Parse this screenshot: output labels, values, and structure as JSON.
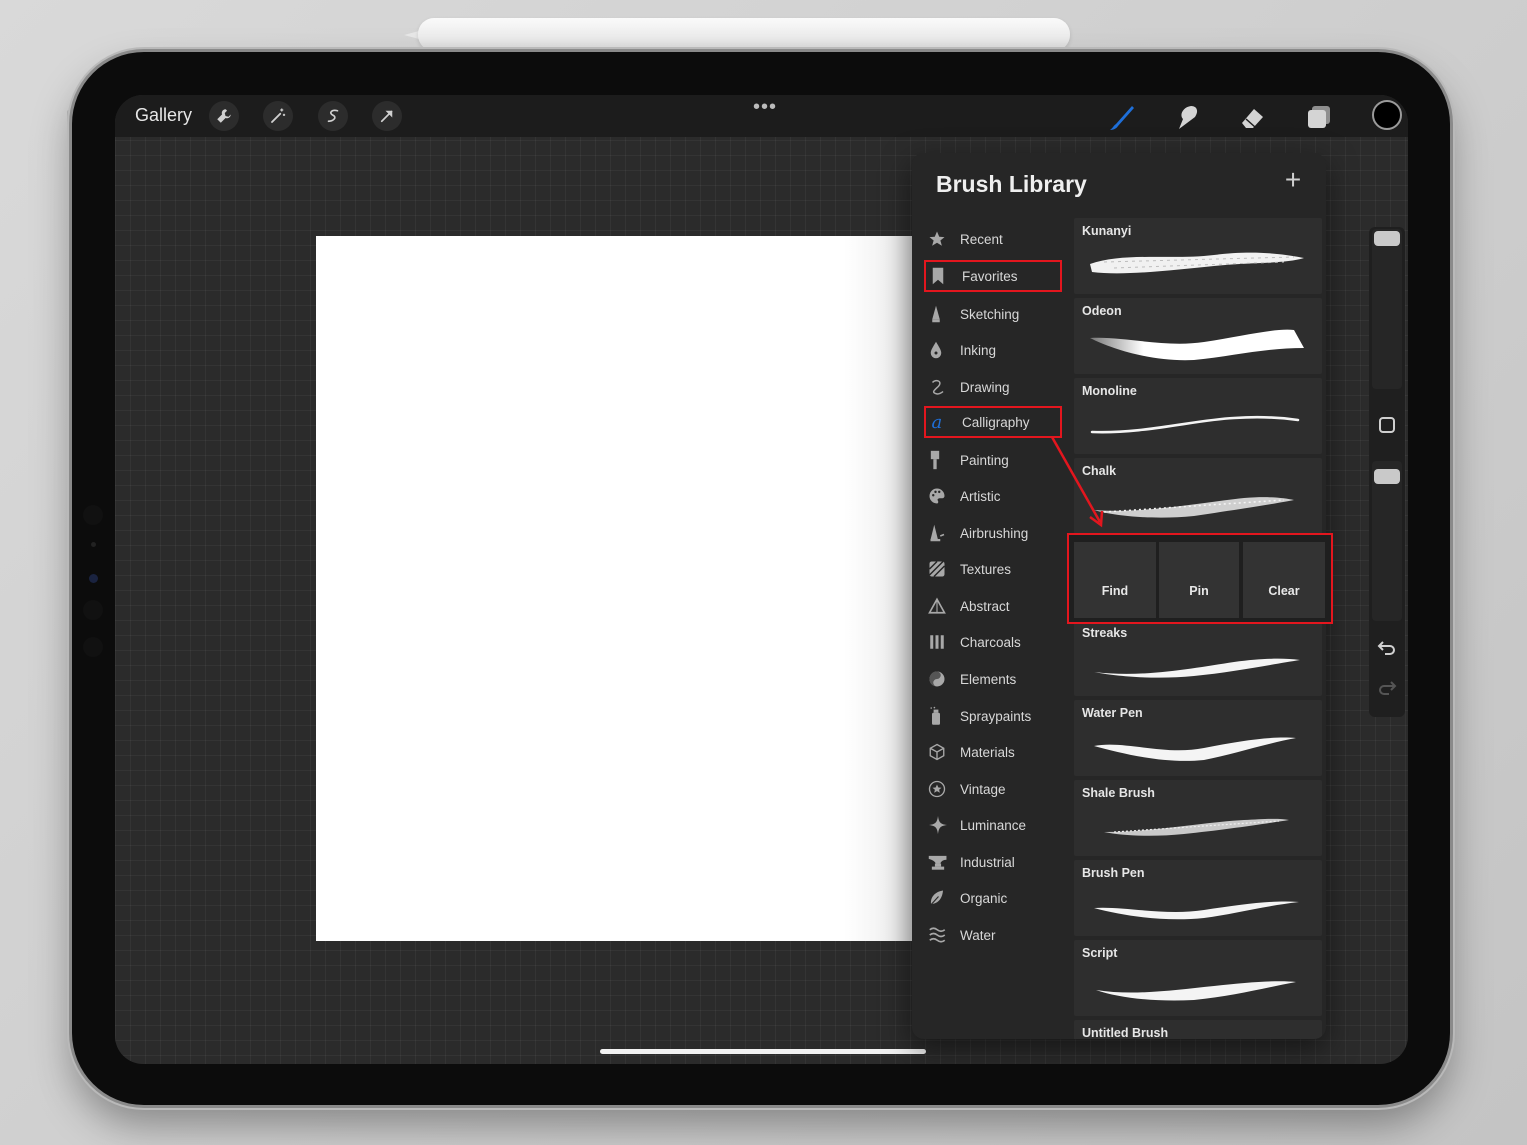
{
  "topbar": {
    "gallery_label": "Gallery",
    "more_label": "•••"
  },
  "panel": {
    "title": "Brush Library",
    "add_label": "+"
  },
  "categories": [
    {
      "label": "Recent",
      "icon": "star-icon",
      "highlighted": false
    },
    {
      "label": "Favorites",
      "icon": "bookmark-icon",
      "highlighted": true
    },
    {
      "label": "Sketching",
      "icon": "pencil-icon",
      "highlighted": false
    },
    {
      "label": "Inking",
      "icon": "ink-drop-icon",
      "highlighted": false
    },
    {
      "label": "Drawing",
      "icon": "squiggle-icon",
      "highlighted": false
    },
    {
      "label": "Calligraphy",
      "icon": "calligraphy-a-icon",
      "highlighted": true
    },
    {
      "label": "Painting",
      "icon": "paint-brush-icon",
      "highlighted": false
    },
    {
      "label": "Artistic",
      "icon": "palette-icon",
      "highlighted": false
    },
    {
      "label": "Airbrushing",
      "icon": "airbrush-icon",
      "highlighted": false
    },
    {
      "label": "Textures",
      "icon": "texture-icon",
      "highlighted": false
    },
    {
      "label": "Abstract",
      "icon": "triangle-icon",
      "highlighted": false
    },
    {
      "label": "Charcoals",
      "icon": "charcoal-icon",
      "highlighted": false
    },
    {
      "label": "Elements",
      "icon": "yin-yang-icon",
      "highlighted": false
    },
    {
      "label": "Spraypaints",
      "icon": "spray-can-icon",
      "highlighted": false
    },
    {
      "label": "Materials",
      "icon": "cube-icon",
      "highlighted": false
    },
    {
      "label": "Vintage",
      "icon": "star-badge-icon",
      "highlighted": false
    },
    {
      "label": "Luminance",
      "icon": "sparkle-icon",
      "highlighted": false
    },
    {
      "label": "Industrial",
      "icon": "anvil-icon",
      "highlighted": false
    },
    {
      "label": "Organic",
      "icon": "leaf-icon",
      "highlighted": false
    },
    {
      "label": "Water",
      "icon": "waves-icon",
      "highlighted": false
    }
  ],
  "brushes": [
    {
      "name": "Kunanyi"
    },
    {
      "name": "Odeon"
    },
    {
      "name": "Monoline"
    },
    {
      "name": "Chalk"
    },
    {
      "name": "Streaks"
    },
    {
      "name": "Water Pen"
    },
    {
      "name": "Shale Brush"
    },
    {
      "name": "Brush Pen"
    },
    {
      "name": "Script"
    },
    {
      "name": "Untitled Brush"
    }
  ],
  "actions": {
    "find_label": "Find",
    "pin_label": "Pin",
    "clear_label": "Clear"
  },
  "colors": {
    "highlight": "#e3161e",
    "active_brush": "#1e6fd9",
    "current_color": "#000000"
  }
}
